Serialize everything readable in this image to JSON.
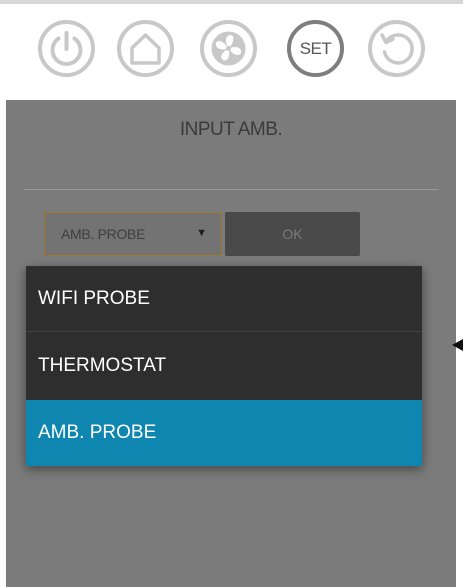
{
  "nav": {
    "buttons": [
      {
        "name": "power",
        "icon": "power-icon",
        "active": false
      },
      {
        "name": "home",
        "icon": "home-icon",
        "active": false
      },
      {
        "name": "fan",
        "icon": "fan-icon",
        "active": false
      },
      {
        "name": "set",
        "label": "SET",
        "active": true
      },
      {
        "name": "reset",
        "icon": "refresh-icon",
        "active": false
      }
    ],
    "set_label": "SET"
  },
  "panel": {
    "title": "INPUT AMB.",
    "select": {
      "value": "AMB. PROBE",
      "caret": "▼"
    },
    "ok_label": "OK"
  },
  "dropdown": {
    "options": [
      {
        "label": "WIFI PROBE",
        "selected": false
      },
      {
        "label": "THERMOSTAT",
        "selected": false
      },
      {
        "label": "AMB. PROBE",
        "selected": true
      }
    ]
  },
  "colors": {
    "accent": "#0f86b0",
    "overlay": "#7b7b7b",
    "dropdown_bg": "#2e2e2e",
    "select_border": "#a0782f"
  }
}
